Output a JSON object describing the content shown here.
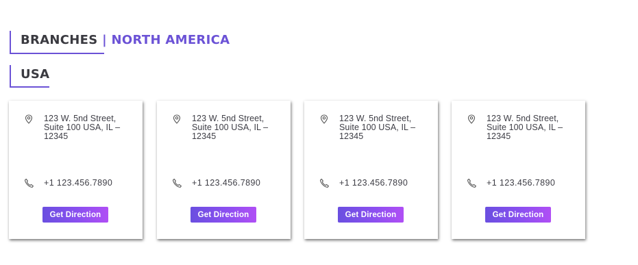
{
  "headings": {
    "branches_label": "BRANCHES",
    "separator": "|",
    "region": "NORTH AMERICA",
    "country": "USA"
  },
  "colors": {
    "accent": "#6b52d6",
    "heading_text": "#3a3a40",
    "button_gradient_start": "#6a4fe0",
    "button_gradient_end": "#b04ff5"
  },
  "cards": [
    {
      "address_line1": "123 W. 5nd Street,",
      "address_line2": "Suite 100 USA, IL –",
      "address_line3": "12345",
      "phone": "+1 123.456.7890",
      "button_label": "Get Direction",
      "address_icon": "map-pin-icon",
      "phone_icon": "phone-icon"
    },
    {
      "address_line1": "123 W. 5nd Street,",
      "address_line2": "Suite 100 USA, IL –",
      "address_line3": "12345",
      "phone": "+1 123.456.7890",
      "button_label": "Get Direction",
      "address_icon": "map-pin-icon",
      "phone_icon": "phone-icon"
    },
    {
      "address_line1": "123 W. 5nd Street,",
      "address_line2": "Suite 100 USA, IL –",
      "address_line3": "12345",
      "phone": "+1 123.456.7890",
      "button_label": "Get Direction",
      "address_icon": "map-pin-icon",
      "phone_icon": "phone-icon"
    },
    {
      "address_line1": "123 W. 5nd Street,",
      "address_line2": "Suite 100 USA, IL –",
      "address_line3": "12345",
      "phone": "+1 123.456.7890",
      "button_label": "Get Direction",
      "address_icon": "map-pin-icon",
      "phone_icon": "phone-icon"
    }
  ]
}
